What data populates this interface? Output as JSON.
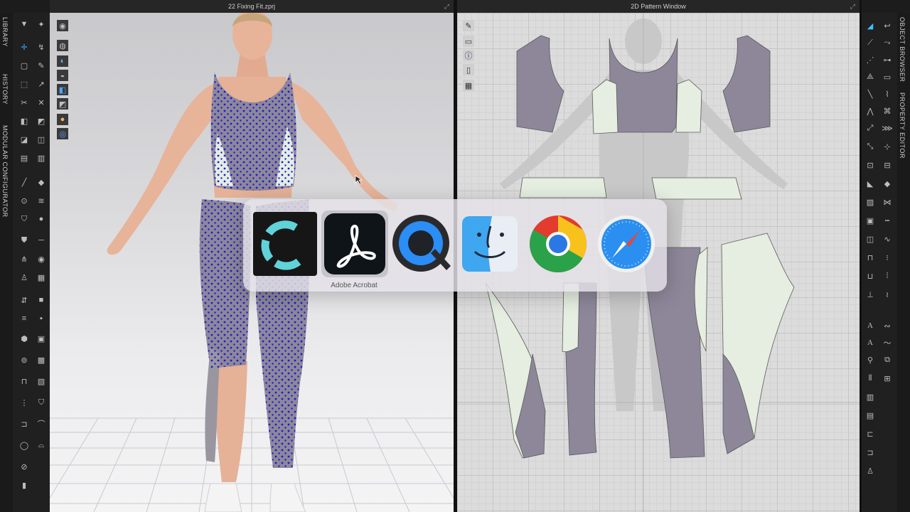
{
  "left_panel": {
    "tabs": [
      "LIBRARY",
      "HISTORY",
      "MODULAR CONFIGURATOR"
    ]
  },
  "right_panel": {
    "tabs": [
      "OBJECT BROWSER",
      "PROPERTY EDITOR"
    ]
  },
  "view3d": {
    "title": "22 Fixing Fit.zprj"
  },
  "view2d": {
    "title": "2D Pattern Window"
  },
  "app_switcher": {
    "apps": [
      {
        "name": "CLO",
        "icon": "clo-app-icon"
      },
      {
        "name": "Adobe Acrobat",
        "icon": "acrobat-app-icon"
      },
      {
        "name": "QuickTime Player",
        "icon": "quicktime-app-icon"
      },
      {
        "name": "Finder",
        "icon": "finder-app-icon"
      },
      {
        "name": "Google Chrome",
        "icon": "chrome-app-icon"
      },
      {
        "name": "Safari",
        "icon": "safari-app-icon"
      }
    ],
    "selected_label": "Adobe Acrobat"
  },
  "colors": {
    "fabric_gray": "#8d8799",
    "fabric_mint": "#e5eee0",
    "point_blue": "#1a1ad8",
    "switcher_bg": "#e4e2e8"
  }
}
